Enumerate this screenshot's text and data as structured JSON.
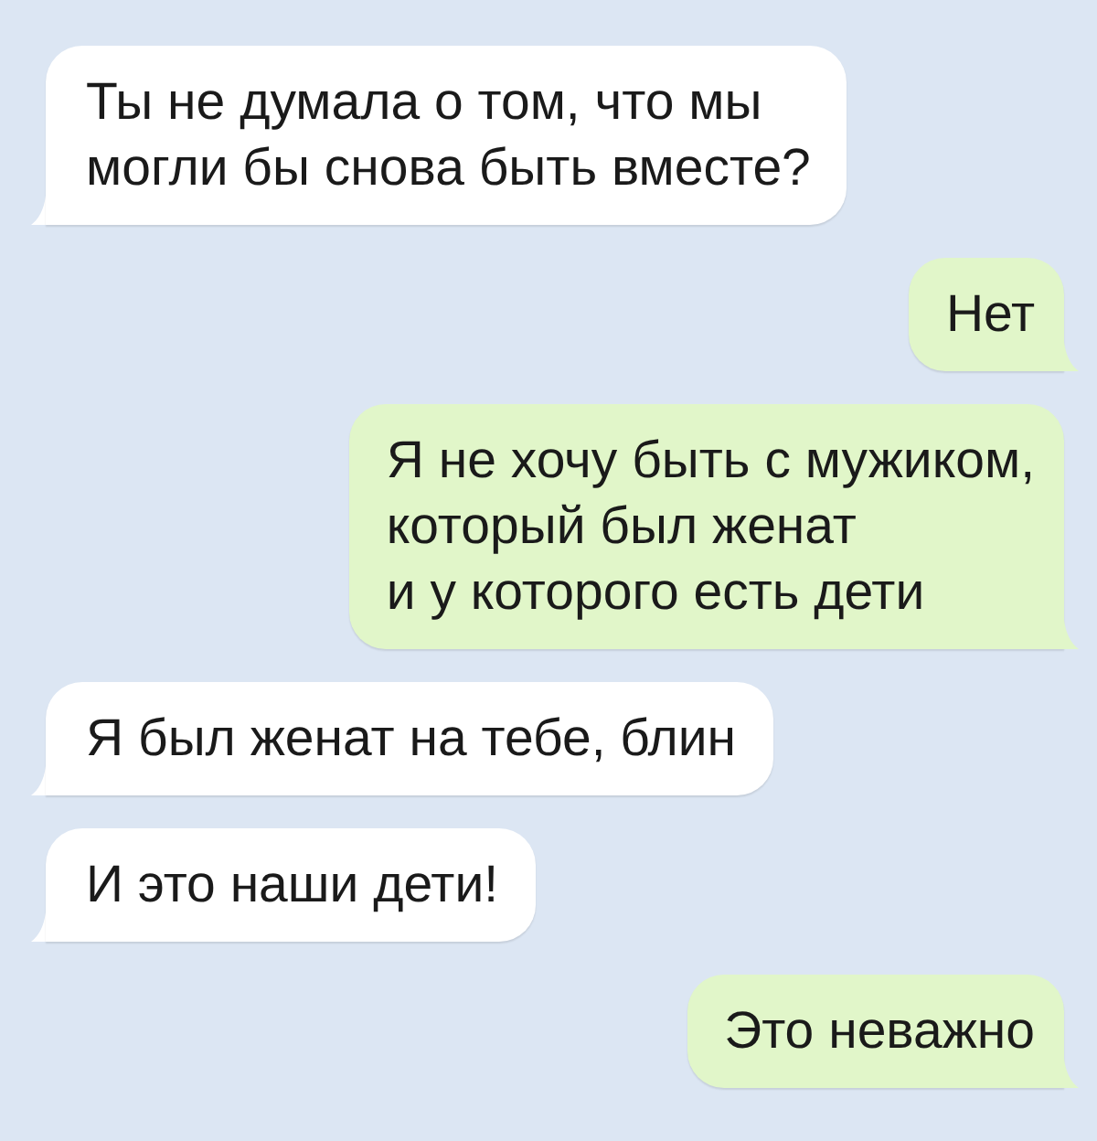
{
  "messages": [
    {
      "kind": "incoming",
      "text": "Ты не думала о том, что мы\nмогли бы снова быть вместе?"
    },
    {
      "kind": "outgoing",
      "text": "Нет"
    },
    {
      "kind": "outgoing",
      "text": "Я не хочу быть с мужиком,\nкоторый был женат\nи у которого есть дети"
    },
    {
      "kind": "incoming",
      "text": "Я был женат на тебе, блин"
    },
    {
      "kind": "incoming",
      "text": "И это наши дети!"
    },
    {
      "kind": "outgoing",
      "text": "Это неважно"
    }
  ]
}
